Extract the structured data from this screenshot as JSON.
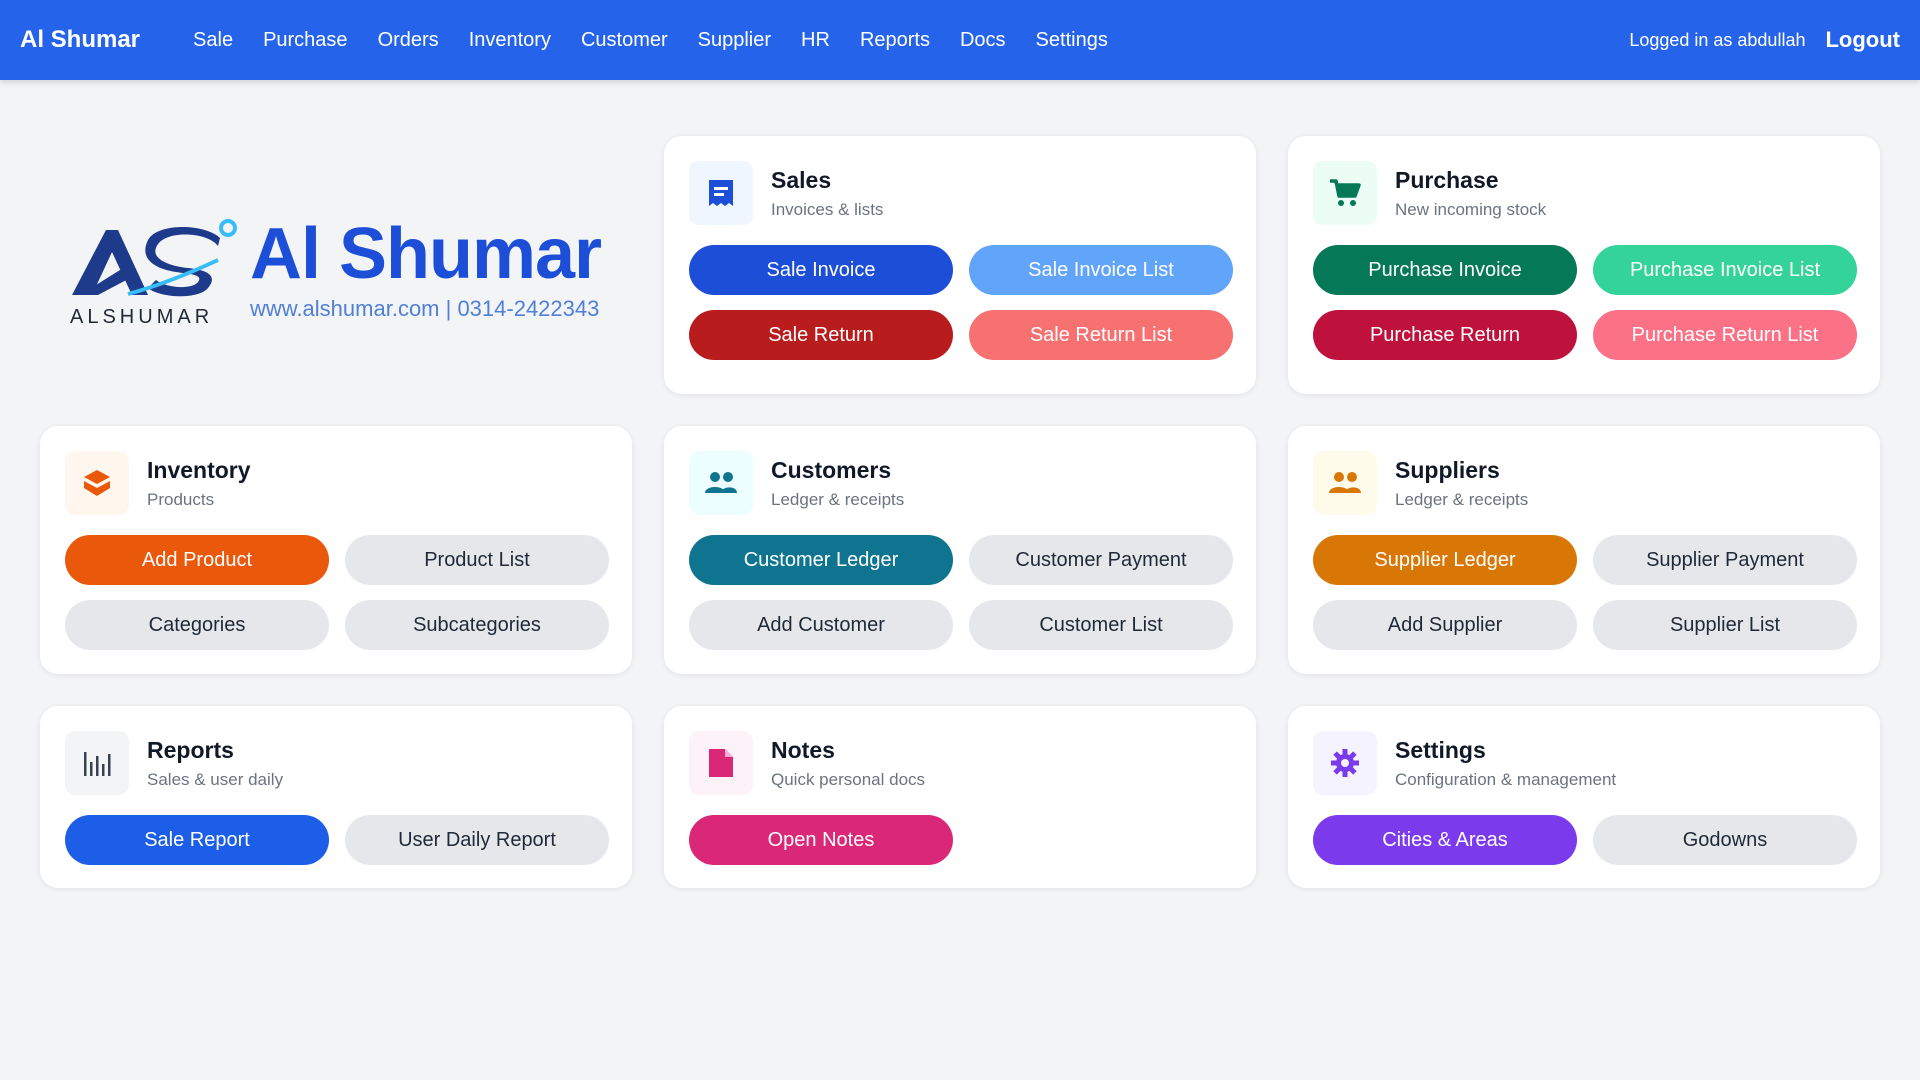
{
  "nav": {
    "brand": "Al Shumar",
    "items": [
      "Sale",
      "Purchase",
      "Orders",
      "Inventory",
      "Customer",
      "Supplier",
      "HR",
      "Reports",
      "Docs",
      "Settings"
    ],
    "logged_in": "Logged in as abdullah",
    "logout": "Logout"
  },
  "logo": {
    "mark_text": "ALSHUMAR",
    "name": "Al Shumar",
    "contact": "www.alshumar.com | 0314-2422343"
  },
  "cards": {
    "sales": {
      "title": "Sales",
      "subtitle": "Invoices & lists",
      "icon": "receipt-icon",
      "buttons": [
        "Sale Invoice",
        "Sale Invoice List",
        "Sale Return",
        "Sale Return List"
      ]
    },
    "purchase": {
      "title": "Purchase",
      "subtitle": "New incoming stock",
      "icon": "cart-icon",
      "buttons": [
        "Purchase Invoice",
        "Purchase Invoice List",
        "Purchase Return",
        "Purchase Return List"
      ]
    },
    "inventory": {
      "title": "Inventory",
      "subtitle": "Products",
      "icon": "box-icon",
      "buttons": [
        "Add Product",
        "Product List",
        "Categories",
        "Subcategories"
      ]
    },
    "customers": {
      "title": "Customers",
      "subtitle": "Ledger & receipts",
      "icon": "people-icon",
      "buttons": [
        "Customer Ledger",
        "Customer Payment",
        "Add Customer",
        "Customer List"
      ]
    },
    "suppliers": {
      "title": "Suppliers",
      "subtitle": "Ledger & receipts",
      "icon": "people-icon",
      "buttons": [
        "Supplier Ledger",
        "Supplier Payment",
        "Add Supplier",
        "Supplier List"
      ]
    },
    "reports": {
      "title": "Reports",
      "subtitle": "Sales & user daily",
      "icon": "bar-chart-icon",
      "buttons": [
        "Sale Report",
        "User Daily Report"
      ]
    },
    "notes": {
      "title": "Notes",
      "subtitle": "Quick personal docs",
      "icon": "note-icon",
      "buttons": [
        "Open Notes"
      ]
    },
    "settings": {
      "title": "Settings",
      "subtitle": "Configuration & management",
      "icon": "gear-icon",
      "buttons": [
        "Cities & Areas",
        "Godowns"
      ]
    }
  },
  "colors": {
    "nav_bg": "#2563eb",
    "sale_primary": "#1d4ed8",
    "sale_light": "#60a5fa",
    "sale_return": "#b91c1c",
    "sale_return_light": "#f87171",
    "purchase_primary": "#047857",
    "purchase_light": "#34d399",
    "purchase_return": "#be123c",
    "purchase_return_light": "#fb7185",
    "inventory": "#ea580c",
    "customers": "#0e7490",
    "suppliers": "#d97706",
    "reports": "#1d5ee8",
    "notes": "#db2777",
    "settings": "#7c3aed"
  }
}
